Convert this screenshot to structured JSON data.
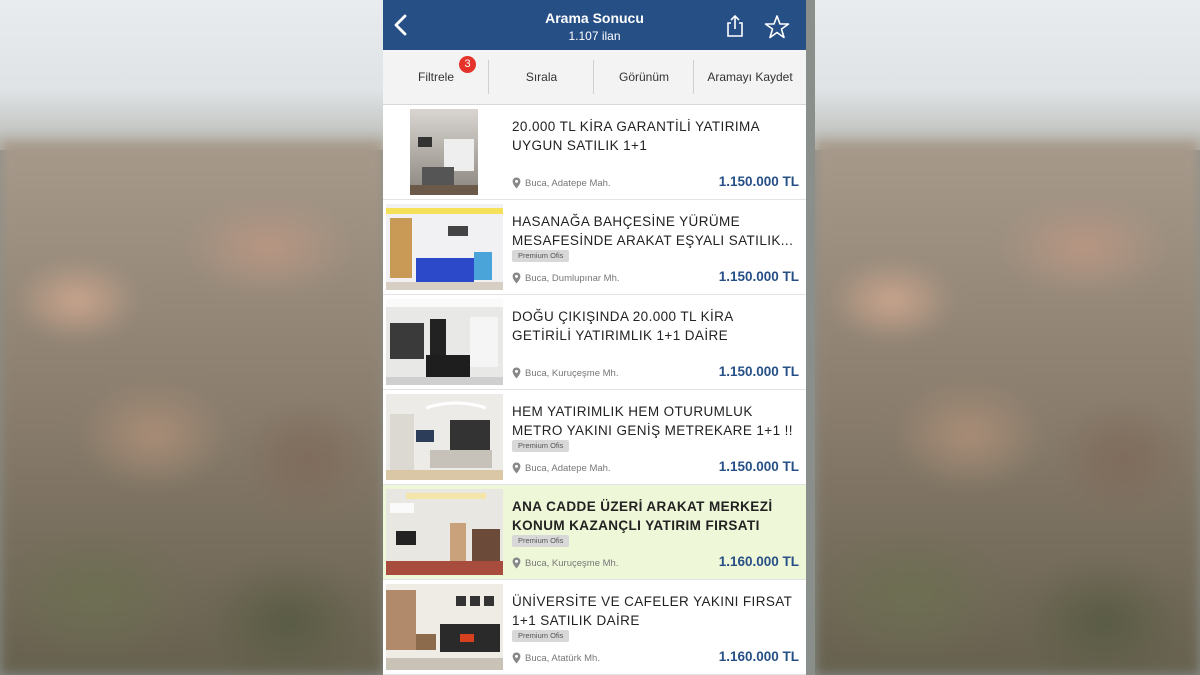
{
  "header": {
    "title": "Arama Sonucu",
    "subtitle": "1.107 ilan"
  },
  "toolbar": {
    "filter_label": "Filtrele",
    "filter_badge": "3",
    "sort_label": "Sırala",
    "view_label": "Görünüm",
    "save_label": "Aramayı Kaydet"
  },
  "listings": [
    {
      "title1": "20.000 TL KİRA GARANTİLİ YATIRIMA",
      "title2": "UYGUN SATILIK 1+1",
      "badge": "",
      "location": "Buca, Adatepe Mah.",
      "price": "1.150.000 TL"
    },
    {
      "title1": "HASANAĞA BAHÇESİNE YÜRÜME",
      "title2": "MESAFESİNDE ARAKAT EŞYALI SATILIK...",
      "badge": "Premium Ofis",
      "location": "Buca, Dumlupınar Mh.",
      "price": "1.150.000 TL"
    },
    {
      "title1": "DOĞU ÇIKIŞINDA 20.000 TL KİRA",
      "title2": "GETİRİLİ YATIRIMLIK 1+1 DAİRE",
      "badge": "",
      "location": "Buca, Kuruçeşme Mh.",
      "price": "1.150.000 TL"
    },
    {
      "title1": "HEM YATIRIMLIK HEM OTURUMLUK",
      "title2": "METRO YAKINI GENİŞ METREKARE 1+1 !!",
      "badge": "Premium Ofis",
      "location": "Buca, Adatepe Mah.",
      "price": "1.150.000 TL"
    },
    {
      "title1": "ANA CADDE ÜZERİ ARAKAT MERKEZİ",
      "title2": "KONUM KAZANÇLI YATIRIM FIRSATI",
      "badge": "Premium Ofis",
      "location": "Buca, Kuruçeşme Mh.",
      "price": "1.160.000 TL"
    },
    {
      "title1": "ÜNİVERSİTE VE CAFELER YAKINI FIRSAT",
      "title2": "1+1 SATILIK DAİRE",
      "badge": "Premium Ofis",
      "location": "Buca, Atatürk Mh.",
      "price": "1.160.000 TL"
    }
  ],
  "colors": {
    "nav_bg": "#264f86",
    "price": "#264f86",
    "badge_red": "#e5332a",
    "highlight_bg": "#eef7d7"
  },
  "icons": [
    "back-chevron-icon",
    "share-icon",
    "star-icon",
    "location-pin-icon"
  ]
}
